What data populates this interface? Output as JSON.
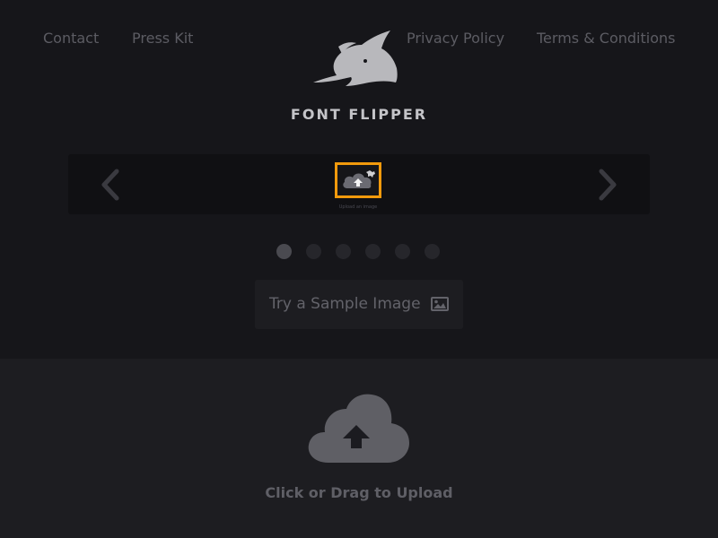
{
  "nav": {
    "contact": "Contact",
    "press_kit": "Press Kit",
    "privacy_policy": "Privacy Policy",
    "terms": "Terms & Conditions"
  },
  "brand": {
    "name": "FONT FLIPPER",
    "logo_icon": "shark-logo-icon"
  },
  "carousel": {
    "prev_icon": "chevron-left-icon",
    "next_icon": "chevron-right-icon",
    "thumbnail_icon": "cloud-upload-icon",
    "thumbnail_caption": "Upload an image",
    "selected_border_color": "#f29a0c",
    "page_count": 6,
    "active_page": 1
  },
  "sample_button": {
    "label": "Try a Sample Image",
    "icon": "image-icon"
  },
  "upload": {
    "label": "Click or Drag to Upload",
    "icon": "cloud-upload-icon"
  },
  "colors": {
    "top_background": "#16161a",
    "bottom_background": "#1d1d21",
    "accent": "#f29a0c"
  }
}
